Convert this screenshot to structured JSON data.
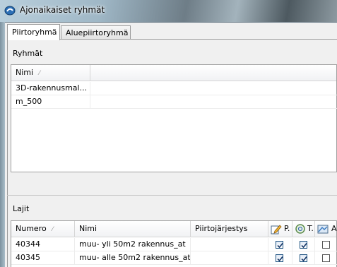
{
  "window": {
    "title": "Ajonaikaiset ryhmät"
  },
  "tabs": [
    {
      "label": "Piirtoryhmä",
      "active": true
    },
    {
      "label": "Aluepiirtoryhmä",
      "active": false
    }
  ],
  "groups": {
    "section_label": "Ryhmät",
    "columns": [
      "Nimi"
    ],
    "rows": [
      {
        "name": "3D-rakennusmal..."
      },
      {
        "name": "m_500"
      }
    ]
  },
  "types": {
    "section_label": "Lajit",
    "columns": {
      "numero": "Numero",
      "nimi": "Nimi",
      "order": "Piirtojärjestys",
      "col_p": "P.",
      "col_t": "T.",
      "col_a": "A"
    },
    "rows": [
      {
        "numero": "40344",
        "nimi": "muu- yli 50m2 rakennus_at",
        "order": "",
        "p": true,
        "t": true,
        "a": false
      },
      {
        "numero": "40345",
        "nimi": "muu- alle 50m2 rakennus_at",
        "order": "",
        "p": true,
        "t": true,
        "a": false
      }
    ]
  },
  "icons": {
    "app": "app-logo-icon",
    "col_p": "pencil-edit-icon",
    "col_t": "zoom-circle-icon",
    "col_a": "area-fill-icon"
  }
}
